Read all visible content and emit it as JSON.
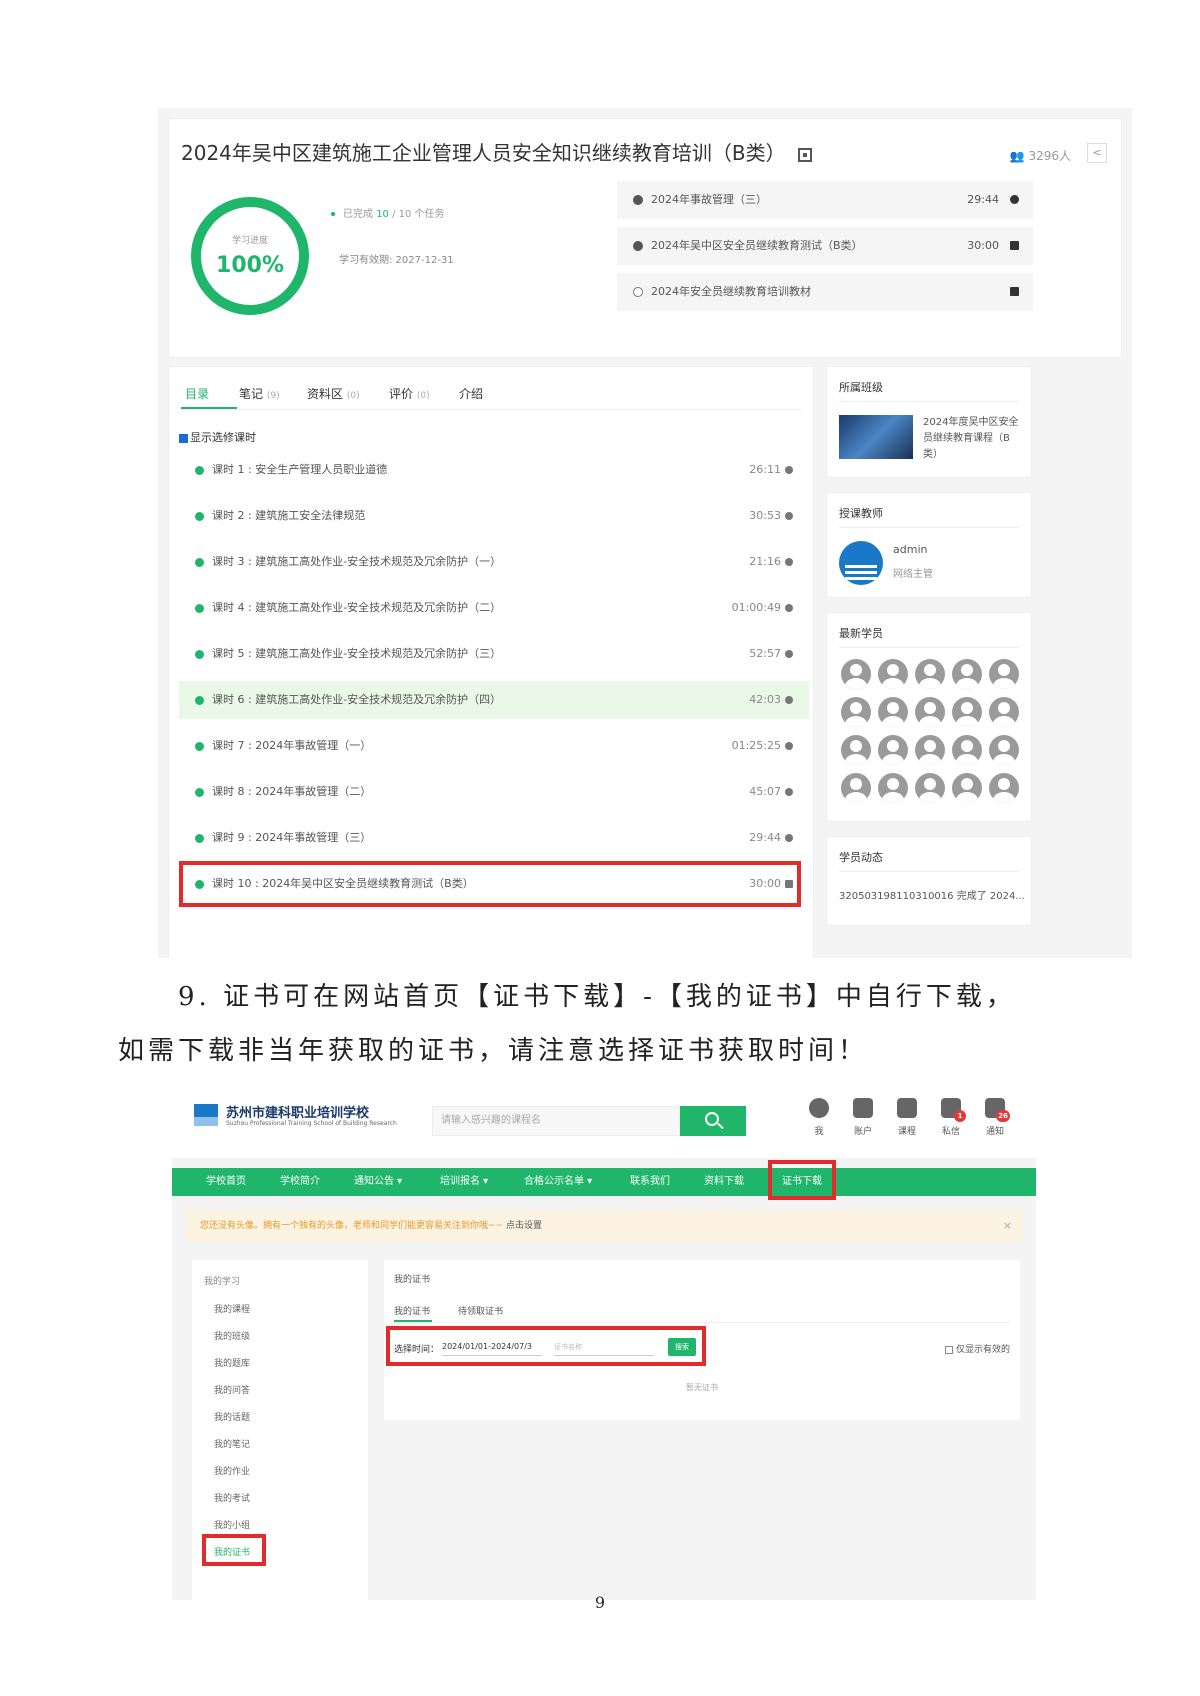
{
  "course": {
    "title": "2024年吴中区建筑施工企业管理人员安全知识继续教育培训（B类）",
    "student_count": "3296人",
    "progress_label": "学习进度",
    "progress_value": "100%",
    "progress_fraction": 1.0,
    "done_tasks_prefix": "已完成 ",
    "done_tasks_value": "10",
    "done_tasks_suffix": " / 10 个任务",
    "validity": "学习有效期:   2027-12-31",
    "tasks": [
      {
        "title": "2024年事故管理（三）",
        "time": "29:44",
        "icon": "play-icon",
        "done": true
      },
      {
        "title": "2024年吴中区安全员继续教育测试（B类）",
        "time": "30:00",
        "icon": "exam-icon",
        "done": true
      },
      {
        "title": "2024年安全员继续教育培训教材",
        "time": "",
        "icon": "document-icon",
        "done": false
      }
    ]
  },
  "tabs": {
    "catalog": "目录",
    "notes": "笔记",
    "notes_count": "(9)",
    "materials": "资料区",
    "materials_count": "(0)",
    "reviews": "评价",
    "reviews_count": "(0)",
    "intro": "介绍"
  },
  "show_elective": "显示选修课时",
  "lessons": [
    {
      "label": "课时 1 : 安全生产管理人员职业道德",
      "duration": "26:11"
    },
    {
      "label": "课时 2 : 建筑施工安全法律规范",
      "duration": "30:53"
    },
    {
      "label": "课时 3 : 建筑施工高处作业-安全技术规范及冗余防护（一）",
      "duration": "21:16"
    },
    {
      "label": "课时 4 : 建筑施工高处作业-安全技术规范及冗余防护（二）",
      "duration": "01:00:49"
    },
    {
      "label": "课时 5 : 建筑施工高处作业-安全技术规范及冗余防护（三）",
      "duration": "52:57"
    },
    {
      "label": "课时 6 : 建筑施工高处作业-安全技术规范及冗余防护（四）",
      "duration": "42:03"
    },
    {
      "label": "课时 7 : 2024年事故管理（一）",
      "duration": "01:25:25"
    },
    {
      "label": "课时 8 : 2024年事故管理（二）",
      "duration": "45:07"
    },
    {
      "label": "课时 9 : 2024年事故管理（三）",
      "duration": "29:44"
    },
    {
      "label": "课时 10 : 2024年吴中区安全员继续教育测试（B类）",
      "duration": "30:00"
    }
  ],
  "sidebar": {
    "class_heading": "所属班级",
    "class_name": "2024年度吴中区安全员继续教育课程（B类）",
    "teacher_heading": "授课教师",
    "teacher_name": "admin",
    "teacher_role": "网络主管",
    "students_heading": "最新学员",
    "activity_heading": "学员动态",
    "activity_text": "320503198110310016 完成了 2024..."
  },
  "instruction": {
    "line1": "9. 证书可在网站首页【证书下载】-【我的证书】中自行下载，",
    "line2": "如需下载非当年获取的证书，请注意选择证书获取时间！"
  },
  "site": {
    "school_name": "苏州市建科职业培训学校",
    "school_name_en": "Suzhou Professional Training School of Building Research",
    "search_placeholder": "请输入感兴趣的课程名",
    "top_icons": [
      {
        "label": "我",
        "icon": "user-icon"
      },
      {
        "label": "账户",
        "icon": "wallet-icon"
      },
      {
        "label": "课程",
        "icon": "book-icon"
      },
      {
        "label": "私信",
        "icon": "message-icon",
        "badge": "1"
      },
      {
        "label": "通知",
        "icon": "bell-icon",
        "badge": "26"
      }
    ],
    "nav": [
      "学校首页",
      "学校简介",
      "通知公告 ▾",
      "培训报名 ▾",
      "合格公示名单 ▾",
      "联系我们",
      "资料下载",
      "证书下载"
    ],
    "notice": "您还没有头像。拥有一个独有的头像，老师和同学们能更容易关注到你哦~~ ",
    "notice_link": "点击设置",
    "notice_close": "×",
    "menu_heading": "我的学习",
    "menu": [
      "我的课程",
      "我的班级",
      "我的题库",
      "我的问答",
      "我的话题",
      "我的笔记",
      "我的作业",
      "我的考试",
      "我的小组",
      "我的证书"
    ],
    "cert_title": "我的证书",
    "cert_tabs": [
      "我的证书",
      "待领取证书"
    ],
    "time_label": "选择时间：",
    "date_range": "2024/01/01-2024/07/3",
    "cert_name_placeholder": "证书名称",
    "search_btn": "搜索",
    "valid_only": "仅显示有效的",
    "no_cert": "暂无证书"
  },
  "page_number": "9"
}
